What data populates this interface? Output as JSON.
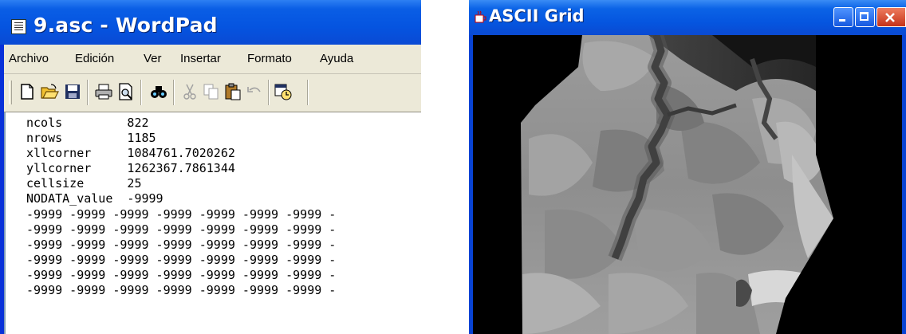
{
  "wordpad": {
    "title": "9.asc - WordPad",
    "menu": [
      "Archivo",
      "Edición",
      "Ver",
      "Insertar",
      "Formato",
      "Ayuda"
    ],
    "toolbar_icons": [
      "new-document-icon",
      "open-folder-icon",
      "save-icon",
      "print-icon",
      "print-preview-icon",
      "find-icon",
      "cut-icon",
      "copy-icon",
      "paste-icon",
      "undo-icon",
      "date-time-icon"
    ],
    "document_lines": [
      "ncols         822",
      "nrows         1185",
      "xllcorner     1084761.7020262",
      "yllcorner     1262367.7861344",
      "cellsize      25",
      "NODATA_value  -9999",
      "-9999 -9999 -9999 -9999 -9999 -9999 -9999 -",
      "-9999 -9999 -9999 -9999 -9999 -9999 -9999 -",
      "-9999 -9999 -9999 -9999 -9999 -9999 -9999 -",
      "-9999 -9999 -9999 -9999 -9999 -9999 -9999 -",
      "-9999 -9999 -9999 -9999 -9999 -9999 -9999 -",
      "-9999 -9999 -9999 -9999 -9999 -9999 -9999 -"
    ]
  },
  "ascii_grid": {
    "title": "ASCII Grid",
    "buttons": [
      "minimize-icon",
      "maximize-icon",
      "close-icon"
    ],
    "image_description_icon": "java-cup-icon"
  },
  "colors": {
    "xp_title_blue": "#0554e0",
    "menu_bg": "#ece9d8",
    "close_red": "#c5331a"
  }
}
